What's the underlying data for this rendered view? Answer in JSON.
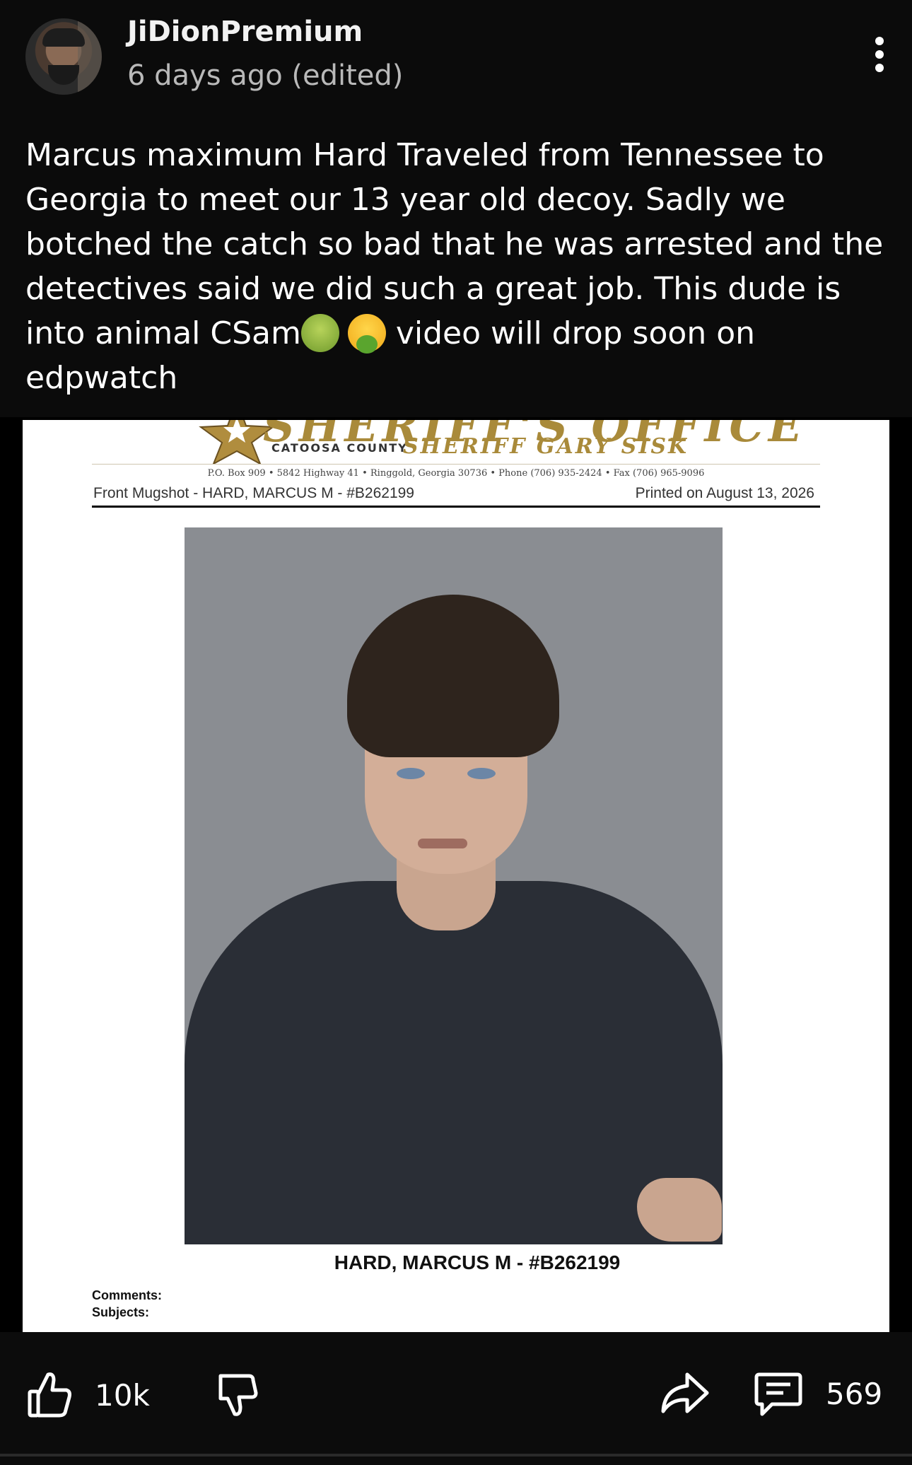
{
  "post": {
    "username": "JiDionPremium",
    "timestamp": "6 days ago (edited)",
    "text_part1": "Marcus maximum Hard Traveled from Tennessee to Georgia to meet our 13 year old decoy. Sadly we botched the catch so bad that he was arrested and the detectives said we did such a great job. This dude is into animal CSam",
    "emoji1": "nauseated-face-emoji",
    "emoji2": "vomiting-face-emoji",
    "text_part2": " video will drop soon on edpwatch"
  },
  "document": {
    "title": "SHERIFF'S OFFICE",
    "county": "CATOOSA COUNTY",
    "sheriff": "SHERIFF GARY SISK",
    "address": "P.O. Box 909 • 5842 Highway 41 • Ringgold, Georgia 30736 • Phone (706) 935-2424 • Fax (706) 965-9096",
    "mugshot_label": "Front Mugshot - HARD, MARCUS M - #B262199",
    "printed_on": "Printed on August 13, 2026",
    "caption": "HARD, MARCUS M - #B262199",
    "comments_label": "Comments:",
    "subjects_label": "Subjects:"
  },
  "actions": {
    "likes": "10k",
    "comments": "569"
  },
  "icons": {
    "like": "thumbs-up-icon",
    "dislike": "thumbs-down-icon",
    "share": "share-arrow-icon",
    "comment": "comment-bubble-icon",
    "more": "more-vertical-icon"
  }
}
